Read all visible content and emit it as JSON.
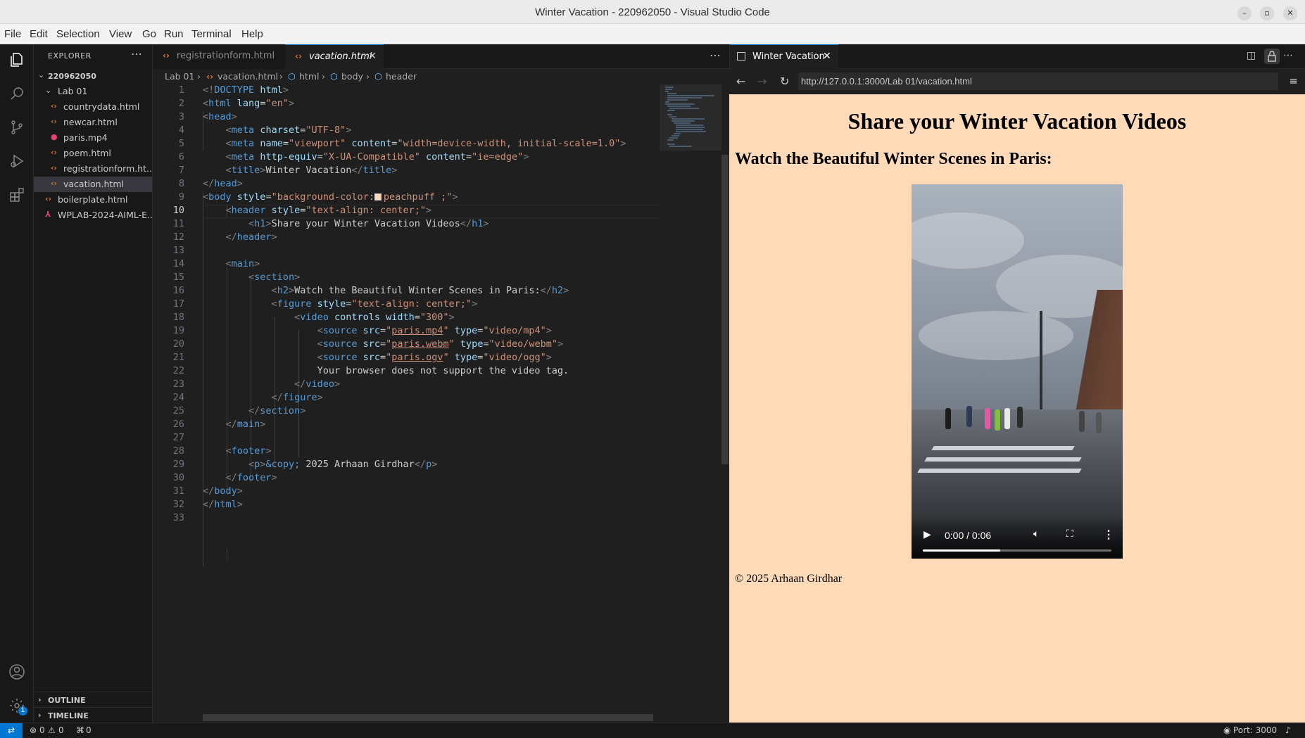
{
  "window": {
    "title": "Winter Vacation - 220962050 - Visual Studio Code"
  },
  "menu": [
    "File",
    "Edit",
    "Selection",
    "View",
    "Go",
    "Run",
    "Terminal",
    "Help"
  ],
  "explorer": {
    "title": "EXPLORER",
    "root": "220962050",
    "folder": "Lab 01",
    "files": [
      {
        "name": "countrydata.html",
        "type": "html"
      },
      {
        "name": "newcar.html",
        "type": "html"
      },
      {
        "name": "paris.mp4",
        "type": "video"
      },
      {
        "name": "poem.html",
        "type": "html"
      },
      {
        "name": "registrationform.ht...",
        "type": "html"
      },
      {
        "name": "vacation.html",
        "type": "html",
        "selected": true
      }
    ],
    "root_files": [
      {
        "name": "boilerplate.html",
        "type": "html"
      },
      {
        "name": "WPLAB-2024-AIML-E...",
        "type": "pdf"
      }
    ],
    "sections": [
      "OUTLINE",
      "TIMELINE"
    ]
  },
  "editor": {
    "tabs": [
      {
        "label": "registrationform.html",
        "active": false
      },
      {
        "label": "vacation.html",
        "active": true
      }
    ],
    "breadcrumb": [
      "Lab 01",
      "vacation.html",
      "html",
      "body",
      "header"
    ],
    "active_line": 10,
    "line_count": 33
  },
  "browser": {
    "tab_label": "Winter Vacation",
    "url": "http://127.0.0.1:3000/Lab 01/vacation.html",
    "page": {
      "h1": "Share your Winter Vacation Videos",
      "h2": "Watch the Beautiful Winter Scenes in Paris:",
      "video_time": "0:00 / 0:06",
      "video_buffered": 0.41,
      "footer": "© 2025 Arhaan Girdhar"
    },
    "background": "#ffdab9"
  },
  "status": {
    "errors": "0",
    "warnings": "0",
    "ports_forwarded": "0",
    "port": "Port: 3000",
    "notification_count": "1"
  },
  "colors": {
    "accent": "#0078d4",
    "html_icon": "#e37933"
  }
}
